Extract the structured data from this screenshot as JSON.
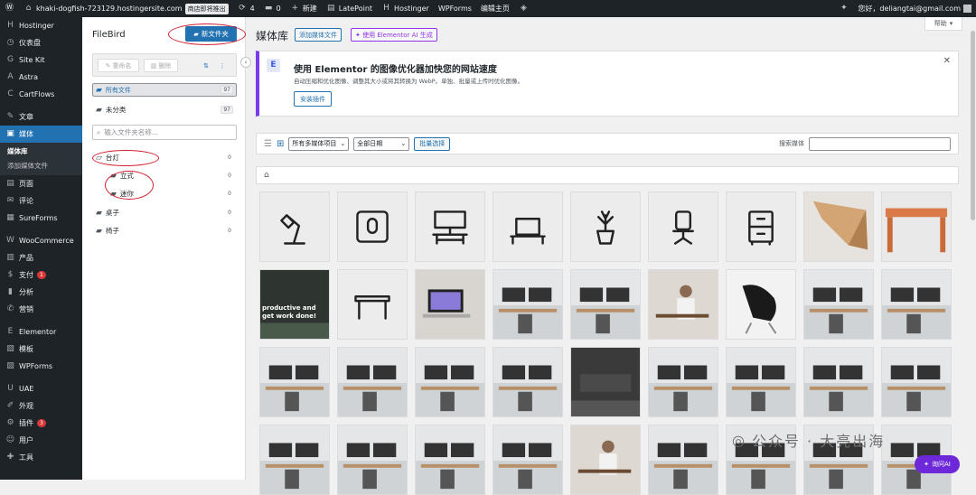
{
  "topbar": {
    "site": "khaki-dogfish-723129.hostingersite.com",
    "badge": "商店即将推出",
    "updates": "4",
    "comments": "0",
    "new": "新建",
    "latepoint": "LatePoint",
    "hostinger": "Hostinger",
    "wpforms": "WPForms",
    "edit_home": "编辑主页",
    "greeting": "您好，deliangtai@gmail.com"
  },
  "sidebar": {
    "items": [
      {
        "icon": "H",
        "label": "Hostinger"
      },
      {
        "icon": "◷",
        "label": "仪表盘"
      },
      {
        "icon": "G",
        "label": "Site Kit"
      },
      {
        "icon": "A",
        "label": "Astra"
      },
      {
        "icon": "C",
        "label": "CartFlows"
      },
      {
        "icon": "✎",
        "label": "文章"
      },
      {
        "icon": "▣",
        "label": "媒体",
        "active": true
      },
      {
        "icon": "▤",
        "label": "页面"
      },
      {
        "icon": "✉",
        "label": "评论"
      },
      {
        "icon": "▦",
        "label": "SureForms"
      },
      {
        "icon": "W",
        "label": "WooCommerce"
      },
      {
        "icon": "▥",
        "label": "产品"
      },
      {
        "icon": "$",
        "label": "支付",
        "count": "1"
      },
      {
        "icon": "▮",
        "label": "分析"
      },
      {
        "icon": "✆",
        "label": "营销"
      },
      {
        "icon": "E",
        "label": "Elementor"
      },
      {
        "icon": "▧",
        "label": "模板"
      },
      {
        "icon": "▨",
        "label": "WPForms"
      },
      {
        "icon": "U",
        "label": "UAE"
      },
      {
        "icon": "✐",
        "label": "外观"
      },
      {
        "icon": "⚙",
        "label": "插件",
        "count": "3"
      },
      {
        "icon": "☺",
        "label": "用户"
      },
      {
        "icon": "✚",
        "label": "工具"
      }
    ],
    "media_sub": [
      "媒体库",
      "添加媒体文件"
    ]
  },
  "filebird": {
    "title": "FileBird",
    "new_folder": "新文件夹",
    "rename": "重命名",
    "delete": "删除",
    "all_files": "所有文件",
    "all_count": "97",
    "uncategorized": "未分类",
    "uncat_count": "97",
    "search_placeholder": "输入文件夹名称...",
    "folders": [
      {
        "name": "台灯",
        "count": "0"
      },
      {
        "name": "立式",
        "count": "0"
      },
      {
        "name": "迷你",
        "count": "0"
      },
      {
        "name": "桌子",
        "count": "0"
      },
      {
        "name": "椅子",
        "count": "0"
      }
    ]
  },
  "main": {
    "title": "媒体库",
    "add_media": "添加媒体文件",
    "ai_generate": "使用 Elementor AI 生成",
    "help": "帮助",
    "notice": {
      "logo": "E",
      "heading": "使用 Elementor 的图像优化器加快您的网站速度",
      "text": "自动压缩和优化图像、调整其大小或将其转换为 WebP。单独、批量或上传时优化图像。",
      "button": "安装插件"
    },
    "filter_type": "所有多媒体项目",
    "filter_date": "全部日期",
    "bulk_select": "批量选择",
    "search_label": "搜索媒体"
  },
  "tiles": [
    {
      "k": "icon-lamp"
    },
    {
      "k": "icon-mouse"
    },
    {
      "k": "icon-desk-monitor"
    },
    {
      "k": "icon-laptop"
    },
    {
      "k": "icon-plant"
    },
    {
      "k": "icon-chair"
    },
    {
      "k": "icon-cabinet"
    },
    {
      "k": "photo-wood-corner"
    },
    {
      "k": "photo-wood-table"
    },
    {
      "k": "photo-dark-text",
      "text": "productive and get work done!"
    },
    {
      "k": "icon-table"
    },
    {
      "k": "photo-laptop"
    },
    {
      "k": "photo-office"
    },
    {
      "k": "photo-office"
    },
    {
      "k": "photo-person"
    },
    {
      "k": "photo-black-chair"
    },
    {
      "k": "photo-office"
    },
    {
      "k": "photo-office"
    },
    {
      "k": "photo-office"
    },
    {
      "k": "photo-office"
    },
    {
      "k": "photo-office"
    },
    {
      "k": "photo-office"
    },
    {
      "k": "photo-dark-room"
    },
    {
      "k": "photo-office"
    },
    {
      "k": "photo-office"
    },
    {
      "k": "photo-office"
    },
    {
      "k": "photo-office"
    },
    {
      "k": "photo-office"
    },
    {
      "k": "photo-office"
    },
    {
      "k": "photo-office"
    },
    {
      "k": "photo-office"
    },
    {
      "k": "photo-person"
    },
    {
      "k": "photo-office"
    },
    {
      "k": "photo-office"
    },
    {
      "k": "photo-office"
    },
    {
      "k": "photo-office"
    }
  ],
  "watermark": "公众号 · 大亮出海",
  "ai_button": "询问AI"
}
